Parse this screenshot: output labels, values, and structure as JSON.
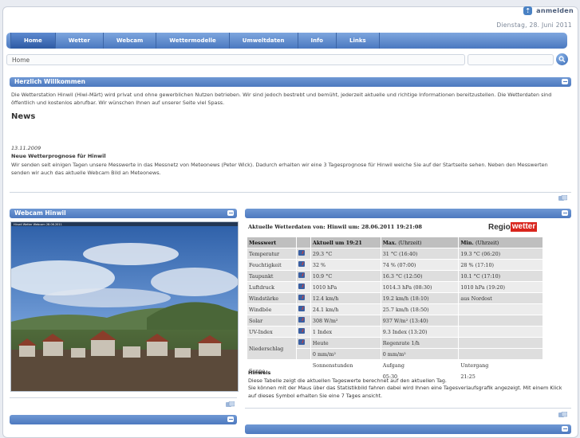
{
  "header": {
    "login_label": "anmelden",
    "date": "Dienstag, 28. Juni 2011"
  },
  "nav": {
    "items": [
      {
        "label": "Home"
      },
      {
        "label": "Wetter"
      },
      {
        "label": "Webcam"
      },
      {
        "label": "Wettermodelle"
      },
      {
        "label": "Umweltdaten"
      },
      {
        "label": "Info"
      },
      {
        "label": "Links"
      }
    ]
  },
  "breadcrumb": "Home",
  "search": {
    "placeholder": ""
  },
  "welcome": {
    "title": "Herzlich Willkommen",
    "text": "Die Wetterstation Hinwil (Hiwi-Märt) wird privat und ohne gewerblichen Nutzen betrieben. Wir sind jedoch bestrebt und bemüht, jederzeit aktuelle und richtige Informationen bereitzustellen. Die Wetterdaten sind öffentlich und kostenlos abrufbar. Wir wünschen Ihnen auf unserer Seite viel Spass.",
    "news_title": "News",
    "news_date": "13.11.2009",
    "news_headline": "Neue Wetterprognose für Hinwil",
    "news_body": "Wir senden seit einigen Tagen unsere Messwerte in das Messnetz von Meteonews (Peter Wick). Dadurch erhalten wir eine 3 Tagesprognose für Hinwil welche Sie auf der Startseite sehen. Neben den Messwerten senden wir auch das aktuelle Webcam Bild an Meteonews."
  },
  "webcam": {
    "title": "Webcam Hinwil",
    "caption": "Hinwil Wetter Webcam 28.06.2011"
  },
  "weather": {
    "heading": "Aktuelle Wetterdaten von: Hinwil um: 28.06.2011 19:21:08",
    "logo_part1": "Regio",
    "logo_part2": "wetter",
    "columns": {
      "c1": "Messwert",
      "c2": "Aktuell um 19:21",
      "c3_bold": "Max.",
      "c3_norm": "(Uhrzeit)",
      "c4_bold": "Min.",
      "c4_norm": "(Uhrzeit)"
    },
    "rows": [
      {
        "name": "Temperatur",
        "current": "29.3 °C",
        "max": "31 °C (16:40)",
        "min": "19.3 °C  (06:20)"
      },
      {
        "name": "Feuchtigkeit",
        "current": "32 %",
        "max": "74 %  (07:00)",
        "min": "28 %  (17:10)"
      },
      {
        "name": "Taupunkt",
        "current": "10.9 °C",
        "max": "16.3 °C  (12:50)",
        "min": "10.1 °C  (17:10)"
      },
      {
        "name": "Luftdruck",
        "current": "1010 hPa",
        "max": "1014.3 hPa  (08:30)",
        "min": "1010 hPa  (19:20)"
      },
      {
        "name": "Windstärke",
        "current": "12.4 km/h",
        "max": "19.2 km/h  (18:10)",
        "min": "aus Nordost"
      },
      {
        "name": "Windböe",
        "current": "24.1 km/h",
        "max": "25.7 km/h  (18:50)",
        "min": ""
      },
      {
        "name": "Solar",
        "current": "308 W/m²",
        "max": "937 W/m²  (13:40)",
        "min": ""
      },
      {
        "name": "UV-Index",
        "current": "1 Index",
        "max": "9.3 Index  (13:20)",
        "min": ""
      }
    ],
    "rain": {
      "name": "Niederschlag",
      "today_label": "Heute",
      "rate_label": "Regenrate 1/h",
      "today_value": "0 mm/m²",
      "rate_value": "0 mm/m²"
    },
    "sun": {
      "name": "Sonne",
      "c2": "Sonnenstunden",
      "c3": "Aufgang",
      "c4": "Untergang",
      "c3_value": "05:30",
      "c4_value": "21:25"
    },
    "hint_title": "Hinweis",
    "hint_line1": "Diese Tabelle zeigt die aktuellen Tageswerte berechnet auf den aktuellen Tag.",
    "hint_line2": "Sie können mit der Maus über das Statistikbild fahren dabei wird Ihnen eine Tagesverlaufsgrafik angezeigt. Mit einem Klick auf dieses Symbol erhalten Sie eine 7 Tages ansicht."
  }
}
